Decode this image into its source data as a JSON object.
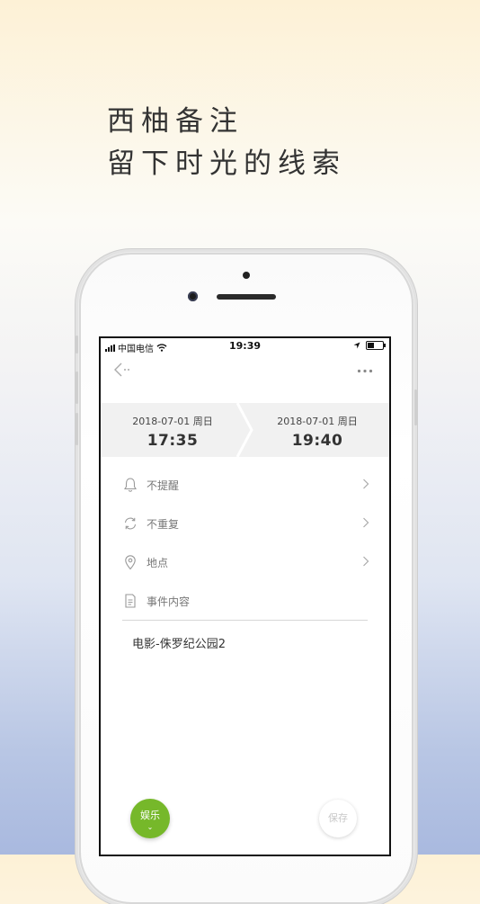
{
  "promo": {
    "line1": "西柚备注",
    "line2": "留下时光的线索"
  },
  "status_bar": {
    "carrier": "中国电信",
    "time": "19:39"
  },
  "time_range": {
    "start": {
      "date": "2018-07-01 周日",
      "time": "17:35"
    },
    "end": {
      "date": "2018-07-01 周日",
      "time": "19:40"
    }
  },
  "options": {
    "reminder": {
      "label": "不提醒",
      "icon": "bell-icon"
    },
    "repeat": {
      "label": "不重复",
      "icon": "refresh-icon"
    },
    "location": {
      "label": "地点",
      "icon": "location-pin-icon"
    },
    "content": {
      "label": "事件内容",
      "icon": "document-icon"
    }
  },
  "event_content": "电影-侏罗纪公园2",
  "actions": {
    "category": "娱乐",
    "save": "保存"
  },
  "colors": {
    "accent_green": "#76b82a",
    "bar_bg": "#f1f1f1",
    "text_muted": "#777777"
  }
}
